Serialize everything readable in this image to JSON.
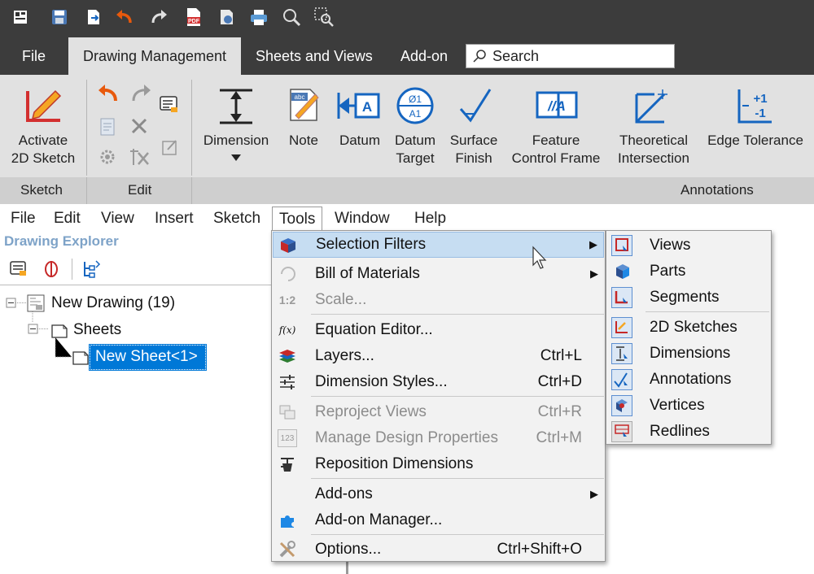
{
  "quick_access": {
    "icons": [
      "app-icon",
      "save-icon",
      "export-icon",
      "undo-icon",
      "redo-icon",
      "pdf-icon",
      "preview-icon",
      "print-icon",
      "zoom-icon",
      "zoom-window-icon"
    ],
    "pdf_text": "PDF"
  },
  "tabs": [
    "File",
    "Drawing Management",
    "Sheets and Views",
    "Add-on"
  ],
  "search": {
    "placeholder": "Search",
    "icon": "search-icon"
  },
  "ribbon": {
    "sketch": {
      "label_line1": "Activate",
      "label_line2": "2D Sketch",
      "group": "Sketch"
    },
    "edit_group": "Edit",
    "annotations_group": "Annotations",
    "buttons": {
      "dimension": "Dimension",
      "note": "Note",
      "datum": "Datum",
      "datum_target_1": "Datum",
      "datum_target_2": "Target",
      "surface_finish_1": "Surface",
      "surface_finish_2": "Finish",
      "fcf_1": "Feature",
      "fcf_2": "Control Frame",
      "theoretical_1": "Theoretical",
      "theoretical_2": "Intersection",
      "edge_tolerance": "Edge Tolerance"
    },
    "note_icon_text": "abc",
    "datum_icon_text": "A",
    "datum_target_icon_text_top": "Ø1",
    "datum_target_icon_text_bottom": "A1",
    "fcf_icon_text": "//A",
    "edge_tol_top": "+1",
    "edge_tol_bottom": "-1"
  },
  "menubar": [
    "File",
    "Edit",
    "View",
    "Insert",
    "Sketch",
    "Tools",
    "Window",
    "Help"
  ],
  "explorer": {
    "title": "Drawing Explorer",
    "tree": {
      "root": "New Drawing (19)",
      "sheets": "Sheets",
      "sheet": "New Sheet<1>"
    }
  },
  "tools_menu": [
    {
      "label": "Selection Filters",
      "shortcut": "",
      "submenu": true,
      "disabled": false,
      "icon": "selection-filter-icon"
    },
    {
      "label": "Bill of Materials",
      "shortcut": "",
      "submenu": true,
      "disabled": false,
      "icon": "bom-icon"
    },
    {
      "label": "Scale...",
      "shortcut": "",
      "submenu": false,
      "disabled": true,
      "icon": "scale-icon",
      "icon_text": "1:2"
    },
    {
      "label": "Equation Editor...",
      "shortcut": "",
      "submenu": false,
      "disabled": false,
      "icon": "equation-icon",
      "icon_text": "f(x)"
    },
    {
      "label": "Layers...",
      "shortcut": "Ctrl+L",
      "submenu": false,
      "disabled": false,
      "icon": "layers-icon"
    },
    {
      "label": "Dimension Styles...",
      "shortcut": "Ctrl+D",
      "submenu": false,
      "disabled": false,
      "icon": "dimension-styles-icon"
    },
    {
      "label": "Reproject Views",
      "shortcut": "Ctrl+R",
      "submenu": false,
      "disabled": true,
      "icon": "reproject-icon"
    },
    {
      "label": "Manage Design Properties",
      "shortcut": "Ctrl+M",
      "submenu": false,
      "disabled": true,
      "icon": "design-properties-icon",
      "icon_text": "123"
    },
    {
      "label": "Reposition Dimensions",
      "shortcut": "",
      "submenu": false,
      "disabled": false,
      "icon": "reposition-icon"
    },
    {
      "label": "Add-ons",
      "shortcut": "",
      "submenu": true,
      "disabled": false,
      "icon": ""
    },
    {
      "label": "Add-on Manager...",
      "shortcut": "",
      "submenu": false,
      "disabled": false,
      "icon": "puzzle-icon"
    },
    {
      "label": "Options...",
      "shortcut": "Ctrl+Shift+O",
      "submenu": false,
      "disabled": false,
      "icon": "options-icon"
    }
  ],
  "selection_filters": [
    {
      "label": "Views",
      "icon": "views-filter-icon"
    },
    {
      "label": "Parts",
      "icon": "parts-filter-icon"
    },
    {
      "label": "Segments",
      "icon": "segments-filter-icon"
    },
    {
      "label": "2D Sketches",
      "icon": "sketches-filter-icon"
    },
    {
      "label": "Dimensions",
      "icon": "dimensions-filter-icon"
    },
    {
      "label": "Annotations",
      "icon": "annotations-filter-icon"
    },
    {
      "label": "Vertices",
      "icon": "vertices-filter-icon"
    },
    {
      "label": "Redlines",
      "icon": "redlines-filter-icon"
    }
  ],
  "colors": {
    "accent": "#1565c0",
    "highlight": "#c6ddf2",
    "selected": "#0078d7",
    "undo": "#e8590c"
  }
}
